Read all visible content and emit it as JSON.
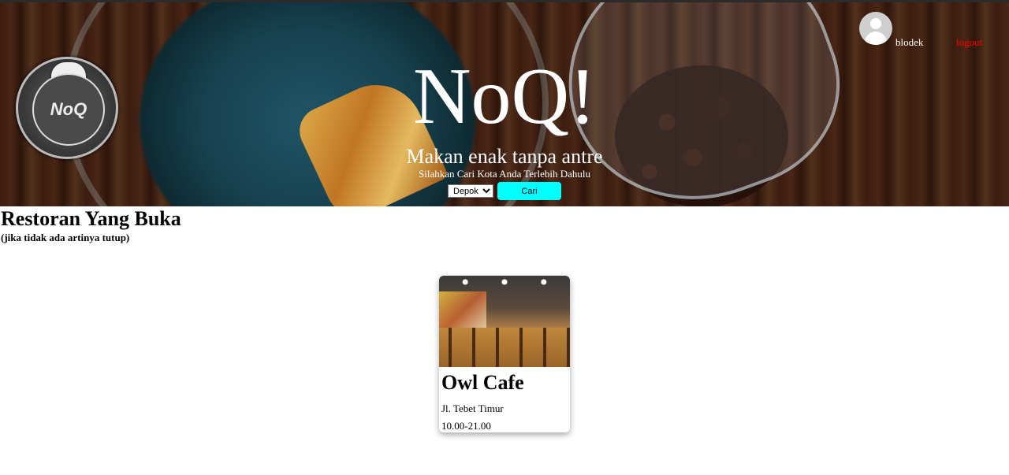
{
  "header": {
    "brand_title": "NoQ!",
    "tagline": "Makan enak tanpa antre",
    "hint": "Silahkan Cari Kota Anda Terlebih Dahulu",
    "city_selected": "Depok",
    "search_label": "Cari",
    "username": "blodek",
    "logout_label": "logout",
    "logo_text": "NoQ"
  },
  "main": {
    "title": "Restoran Yang Buka",
    "subtitle": "(jika tidak ada artinya tutup)",
    "restaurants": [
      {
        "name": "Owl Cafe",
        "address": "Jl. Tebet Timur",
        "hours": "10.00-21.00"
      }
    ]
  },
  "colors": {
    "search_button": "#00ffff",
    "logout_link": "#ff0000"
  }
}
